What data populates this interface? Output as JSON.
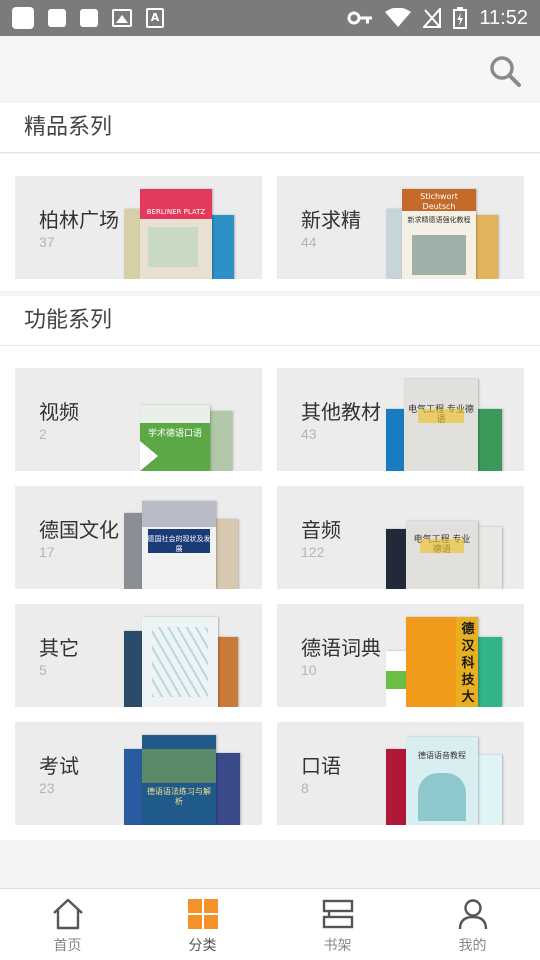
{
  "status_bar": {
    "time": "11:52"
  },
  "sections": [
    {
      "title": "精品系列"
    },
    {
      "title": "功能系列"
    }
  ],
  "cards": [
    {
      "name": "柏林广场",
      "count": "37"
    },
    {
      "name": "新求精",
      "count": "44"
    },
    {
      "name": "视频",
      "count": "2"
    },
    {
      "name": "其他教材",
      "count": "43"
    },
    {
      "name": "德国文化",
      "count": "17"
    },
    {
      "name": "音频",
      "count": "122"
    },
    {
      "name": "其它",
      "count": "5"
    },
    {
      "name": "德语词典",
      "count": "10"
    },
    {
      "name": "考试",
      "count": "23"
    },
    {
      "name": "口语",
      "count": "8"
    }
  ],
  "covers": {
    "berlin": "BERLINER PLATZ",
    "xqj": "Stichwort Deutsch",
    "xqj_sub": "新求精德语强化教程",
    "video": "学术德语口语",
    "other": "电气工程 专业德语",
    "culture": "德国社会的现状及发展",
    "audio": "电气工程 专业德语",
    "dict": "德汉科技大词典",
    "exam": "德语语法练习与解析",
    "oral": "德语语音教程"
  },
  "tabs": [
    {
      "label": "首页"
    },
    {
      "label": "分类"
    },
    {
      "label": "书架"
    },
    {
      "label": "我的"
    }
  ],
  "colors": {
    "accent": "#f4922a",
    "statusbar": "#7b7b7b",
    "card_bg": "#ececec"
  }
}
